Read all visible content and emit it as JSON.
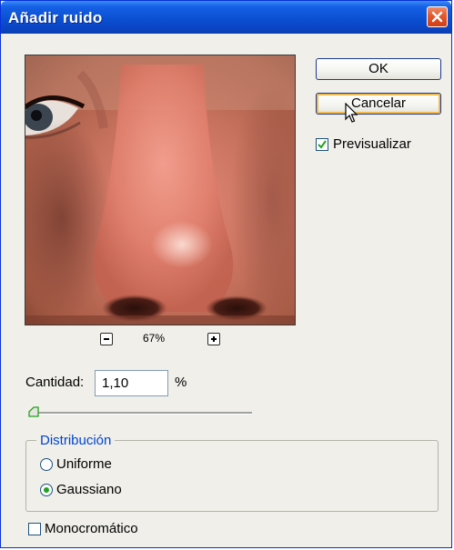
{
  "dialog": {
    "title": "Añadir ruido"
  },
  "buttons": {
    "ok_label": "OK",
    "cancel_label": "Cancelar"
  },
  "preview": {
    "checkbox_label": "Previsualizar",
    "checked": true,
    "zoom_level": "67%"
  },
  "amount": {
    "label": "Cantidad:",
    "value": "1,10",
    "unit": "%"
  },
  "slider": {
    "value_percent": 1.1
  },
  "distribution": {
    "legend": "Distribución",
    "options": [
      {
        "label": "Uniforme",
        "selected": false
      },
      {
        "label": "Gaussiano",
        "selected": true
      }
    ]
  },
  "monochrome": {
    "label": "Monocromático",
    "checked": false
  },
  "colors": {
    "titlebar": "#0a4ecf",
    "dialog_bg": "#f0efe9",
    "accent_blue": "#0046d5",
    "radio_dot": "#21a121",
    "close_red": "#e3572b"
  },
  "icons": [
    "close-icon",
    "zoom-out-icon",
    "zoom-in-icon",
    "checkmark-icon",
    "mouse-cursor-icon"
  ]
}
